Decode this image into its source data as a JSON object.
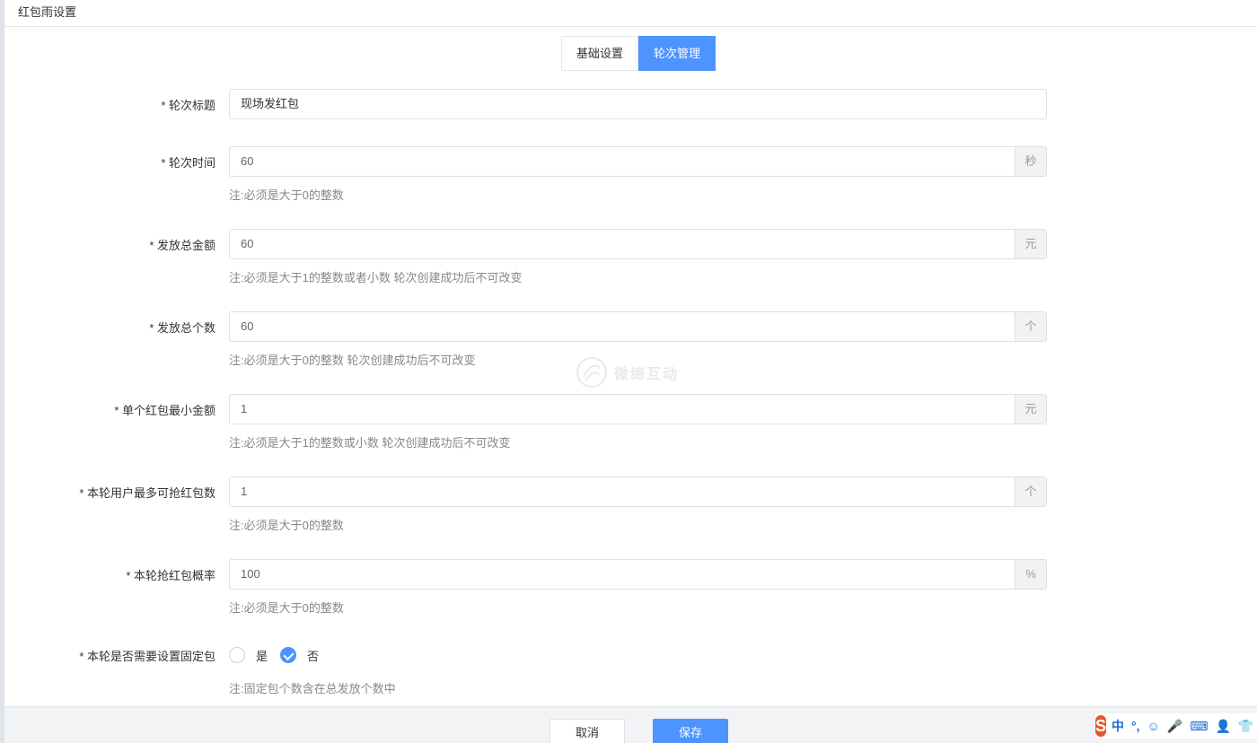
{
  "header": {
    "title": "红包雨设置"
  },
  "tabs": [
    {
      "label": "基础设置",
      "active": false
    },
    {
      "label": "轮次管理",
      "active": true
    }
  ],
  "form": {
    "round_title": {
      "label": "* 轮次标题",
      "value": "现场发红包"
    },
    "round_time": {
      "label": "* 轮次时间",
      "value": "60",
      "suffix": "秒",
      "note": "注:必须是大于0的整数"
    },
    "total_amount": {
      "label": "* 发放总金额",
      "value": "60",
      "suffix": "元",
      "note": "注:必须是大于1的整数或者小数 轮次创建成功后不可改变"
    },
    "total_count": {
      "label": "* 发放总个数",
      "value": "60",
      "suffix": "个",
      "note": "注:必须是大于0的整数 轮次创建成功后不可改变"
    },
    "min_amount": {
      "label": "* 单个红包最小金额",
      "value": "1",
      "suffix": "元",
      "note": "注:必须是大于1的整数或小数 轮次创建成功后不可改变"
    },
    "max_per_user": {
      "label": "* 本轮用户最多可抢红包数",
      "value": "1",
      "suffix": "个",
      "note": "注:必须是大于0的整数"
    },
    "probability": {
      "label": "* 本轮抢红包概率",
      "value": "100",
      "suffix": "%",
      "note": "注:必须是大于0的整数"
    },
    "fixed_packet": {
      "label": "* 本轮是否需要设置固定包",
      "options": [
        {
          "label": "是",
          "checked": false
        },
        {
          "label": "否",
          "checked": true
        }
      ],
      "note": "注:固定包个数含在总发放个数中"
    }
  },
  "footer": {
    "cancel_label": "取消",
    "save_label": "保存"
  },
  "watermark": {
    "text": "微缔互动"
  },
  "ime": {
    "logo": "S",
    "items": [
      "中",
      "°,",
      "☺",
      "🎤",
      "⌨",
      "👤",
      "👕"
    ]
  },
  "colors": {
    "primary": "#4d94ff",
    "border": "#dcdfe6",
    "addon_bg": "#f2f2f2"
  }
}
